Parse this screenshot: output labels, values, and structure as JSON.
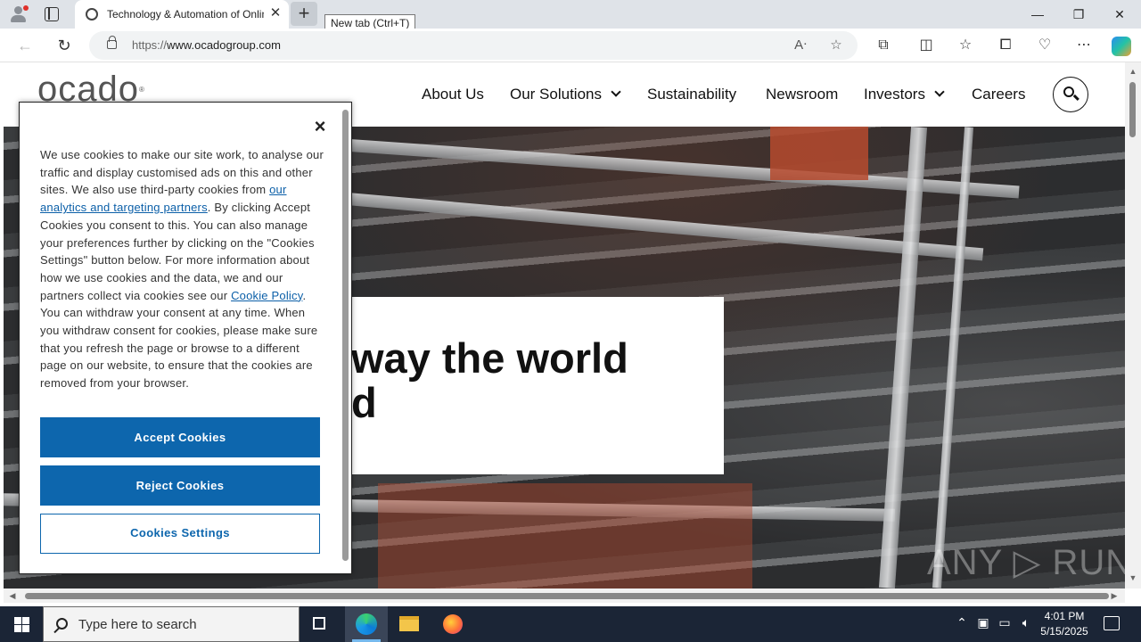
{
  "browser": {
    "tab_title": "Technology & Automation of Online Grocery",
    "new_tab_tooltip": "New tab (Ctrl+T)",
    "url_scheme": "https://",
    "url_host": "www.ocadogroup.com",
    "window_controls": {
      "minimize": "—",
      "restore": "❐",
      "close": "✕"
    }
  },
  "site": {
    "logo": "ocado",
    "logo_mark": "®",
    "nav": [
      {
        "label": "About Us",
        "has_dropdown": false
      },
      {
        "label": "Our Solutions",
        "has_dropdown": true
      },
      {
        "label": "Sustainability",
        "has_dropdown": false
      },
      {
        "label": "Newsroom",
        "has_dropdown": false
      },
      {
        "label": "Investors",
        "has_dropdown": true
      },
      {
        "label": "Careers",
        "has_dropdown": false
      }
    ],
    "hero_line1": "way the world",
    "hero_line2": "d",
    "watermark": "ANY ▷ RUN"
  },
  "cookie_banner": {
    "close_label": "×",
    "text_1": "We use cookies to make our site work, to analyse our traffic and display customised ads on this and other sites. We also use third-party cookies from ",
    "link_partners": "our analytics and targeting partners",
    "text_2": ". By clicking Accept Cookies you consent to this. You can also manage your preferences further by clicking on the \"Cookies Settings\" button below. For more information about how we use cookies and the data, we and our partners collect via cookies see our ",
    "link_policy": "Cookie Policy",
    "text_3": ". You can withdraw your consent at any time. When you withdraw consent for cookies, please make sure that you refresh the page or browse to a different page on our website, to ensure that the cookies are removed from your browser.",
    "accept_label": "Accept Cookies",
    "reject_label": "Reject Cookies",
    "settings_label": "Cookies Settings"
  },
  "taskbar": {
    "search_placeholder": "Type here to search",
    "time": "4:01 PM",
    "date": "5/15/2025"
  },
  "colors": {
    "primary_button": "#0d66ad",
    "link": "#0b5fa8",
    "taskbar": "#1b2536"
  }
}
